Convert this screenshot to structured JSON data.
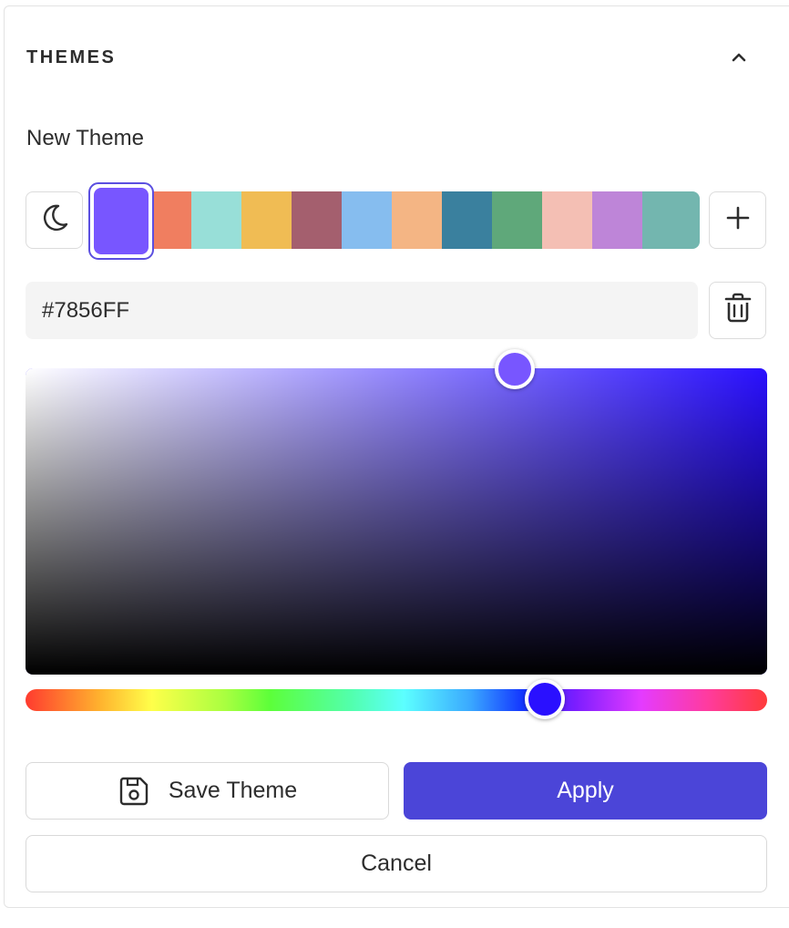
{
  "section": {
    "title": "THEMES"
  },
  "theme": {
    "name": "New Theme"
  },
  "swatches": {
    "selected": "#7856FF",
    "colors": [
      "#F07E60",
      "#98DFD8",
      "#F0BC54",
      "#A45F6E",
      "#86BDEF",
      "#F4B584",
      "#3A809E",
      "#5FA87A",
      "#F4BFB4",
      "#BE85D8",
      "#73B6AF"
    ]
  },
  "color_input": {
    "value": "#7856FF"
  },
  "picker": {
    "hue_color": "#2A10FF"
  },
  "actions": {
    "save_label": "Save Theme",
    "apply_label": "Apply",
    "cancel_label": "Cancel"
  },
  "icons": {
    "collapse": "chevron-up-icon",
    "mode": "moon-icon",
    "add": "plus-icon",
    "delete": "trash-icon",
    "save": "save-icon"
  }
}
